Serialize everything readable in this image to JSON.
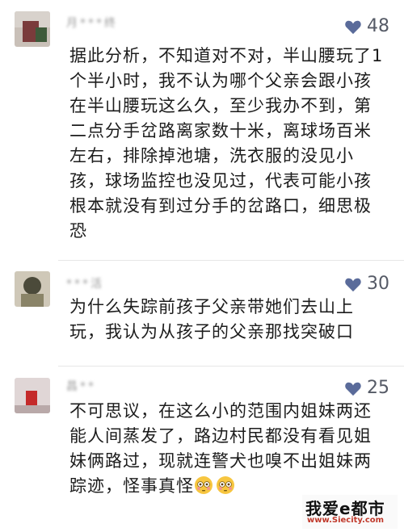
{
  "comments": [
    {
      "username": "月***终",
      "likes": "48",
      "text": "据此分析，不知道对不对，半山腰玩了1个半小时，我不认为哪个父亲会跟小孩在半山腰玩这么久，至少我办不到，第二点分手岔路离家数十米，离球场百米左右，排除掉池塘，洗衣服的没见小孩，球场监控也没见过，代表可能小孩根本就没有到过分手的岔路口，细思极恐"
    },
    {
      "username": "***活",
      "likes": "30",
      "text": "为什么失踪前孩子父亲带她们去山上玩，我认为从孩子的父亲那找突破口"
    },
    {
      "username": "昌**",
      "likes": "25",
      "text": "不可思议，在这么小的范围内姐妹两还能人间蒸发了，路边村民都没有看见姐妹俩路过，现就连警犬也嗅不出姐妹两踪迹，怪事真怪",
      "emojis": [
        "flushed-face",
        "flushed-face"
      ]
    }
  ],
  "watermark": {
    "title": "我爱e都市",
    "url": "www.Siecity.com"
  },
  "colors": {
    "heart": "#5a6b9a",
    "text": "#1c1c1c",
    "watermark_url": "#c0392b"
  }
}
